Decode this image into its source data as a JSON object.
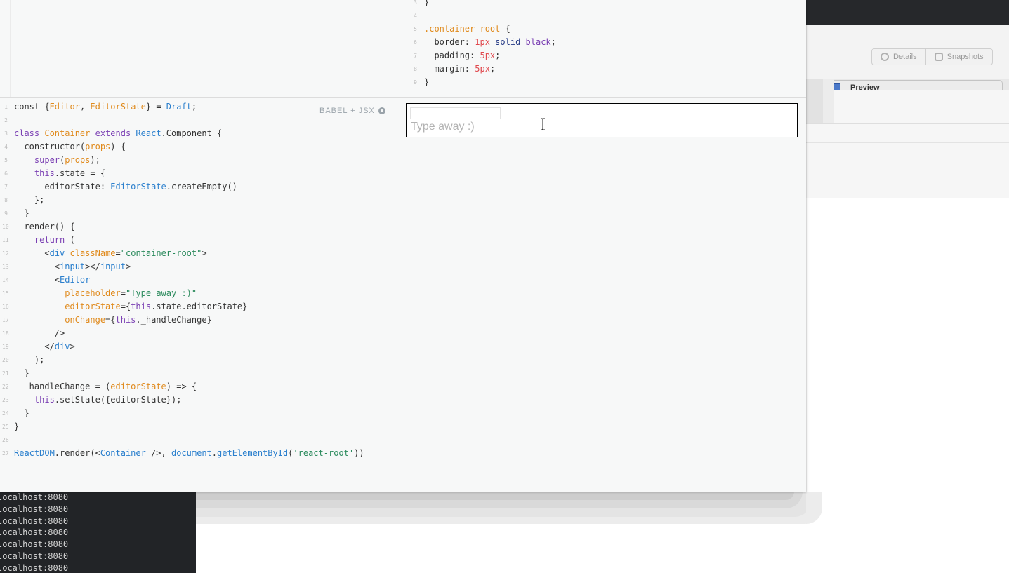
{
  "background_app": {
    "toolbar_buttons": [
      {
        "label": "Details",
        "icon": "gear-icon"
      },
      {
        "label": "Snapshots",
        "icon": "camera-icon"
      }
    ],
    "tab_label": "Preview"
  },
  "css_panel": {
    "lines": [
      {
        "n": "3",
        "tokens": [
          {
            "t": "}",
            "c": ""
          }
        ]
      },
      {
        "n": "4",
        "tokens": []
      },
      {
        "n": "5",
        "tokens": [
          {
            "t": ".container-root",
            "c": "cl"
          },
          {
            "t": " {",
            "c": ""
          }
        ]
      },
      {
        "n": "6",
        "tokens": [
          {
            "t": "  border: ",
            "c": ""
          },
          {
            "t": "1px",
            "c": "num"
          },
          {
            "t": " ",
            "c": ""
          },
          {
            "t": "solid",
            "c": "val"
          },
          {
            "t": " ",
            "c": ""
          },
          {
            "t": "black",
            "c": "kw"
          },
          {
            "t": ";",
            "c": ""
          }
        ]
      },
      {
        "n": "7",
        "tokens": [
          {
            "t": "  padding: ",
            "c": ""
          },
          {
            "t": "5px",
            "c": "num"
          },
          {
            "t": ";",
            "c": ""
          }
        ]
      },
      {
        "n": "8",
        "tokens": [
          {
            "t": "  margin: ",
            "c": ""
          },
          {
            "t": "5px",
            "c": "num"
          },
          {
            "t": ";",
            "c": ""
          }
        ]
      },
      {
        "n": "9",
        "tokens": [
          {
            "t": "}",
            "c": ""
          }
        ]
      }
    ]
  },
  "js_panel": {
    "preprocessor_label": "BABEL + JSX",
    "lines": [
      {
        "n": "1",
        "tokens": [
          {
            "t": "const {",
            "c": ""
          },
          {
            "t": "Editor",
            "c": "cl"
          },
          {
            "t": ", ",
            "c": ""
          },
          {
            "t": "EditorState",
            "c": "cl"
          },
          {
            "t": "} = ",
            "c": ""
          },
          {
            "t": "Draft",
            "c": "ty"
          },
          {
            "t": ";",
            "c": ""
          }
        ]
      },
      {
        "n": "2",
        "tokens": []
      },
      {
        "n": "3",
        "tokens": [
          {
            "t": "class ",
            "c": "kw"
          },
          {
            "t": "Container",
            "c": "cl"
          },
          {
            "t": " extends ",
            "c": "kw"
          },
          {
            "t": "React",
            "c": "ty"
          },
          {
            "t": ".Component {",
            "c": ""
          }
        ]
      },
      {
        "n": "4",
        "tokens": [
          {
            "t": "  constructor(",
            "c": ""
          },
          {
            "t": "props",
            "c": "cl"
          },
          {
            "t": ") {",
            "c": ""
          }
        ]
      },
      {
        "n": "5",
        "tokens": [
          {
            "t": "    ",
            "c": ""
          },
          {
            "t": "super",
            "c": "kw"
          },
          {
            "t": "(",
            "c": ""
          },
          {
            "t": "props",
            "c": "cl"
          },
          {
            "t": ");",
            "c": ""
          }
        ]
      },
      {
        "n": "6",
        "tokens": [
          {
            "t": "    ",
            "c": ""
          },
          {
            "t": "this",
            "c": "kw"
          },
          {
            "t": ".state = {",
            "c": ""
          }
        ]
      },
      {
        "n": "7",
        "tokens": [
          {
            "t": "      editorState: ",
            "c": ""
          },
          {
            "t": "EditorState",
            "c": "ty"
          },
          {
            "t": ".createEmpty()",
            "c": ""
          }
        ]
      },
      {
        "n": "8",
        "tokens": [
          {
            "t": "    };",
            "c": ""
          }
        ]
      },
      {
        "n": "9",
        "tokens": [
          {
            "t": "  }",
            "c": ""
          }
        ]
      },
      {
        "n": "10",
        "tokens": [
          {
            "t": "  render() {",
            "c": ""
          }
        ]
      },
      {
        "n": "11",
        "tokens": [
          {
            "t": "    ",
            "c": ""
          },
          {
            "t": "return",
            "c": "kw"
          },
          {
            "t": " (",
            "c": ""
          }
        ]
      },
      {
        "n": "12",
        "tokens": [
          {
            "t": "      <",
            "c": ""
          },
          {
            "t": "div",
            "c": "tag"
          },
          {
            "t": " ",
            "c": ""
          },
          {
            "t": "className",
            "c": "attr"
          },
          {
            "t": "=",
            "c": ""
          },
          {
            "t": "\"container-root\"",
            "c": "str"
          },
          {
            "t": ">",
            "c": ""
          }
        ]
      },
      {
        "n": "13",
        "tokens": [
          {
            "t": "        <",
            "c": ""
          },
          {
            "t": "input",
            "c": "tag"
          },
          {
            "t": "></",
            "c": ""
          },
          {
            "t": "input",
            "c": "tag"
          },
          {
            "t": ">",
            "c": ""
          }
        ]
      },
      {
        "n": "14",
        "tokens": [
          {
            "t": "        <",
            "c": ""
          },
          {
            "t": "Editor",
            "c": "tag"
          }
        ]
      },
      {
        "n": "15",
        "tokens": [
          {
            "t": "          ",
            "c": ""
          },
          {
            "t": "placeholder",
            "c": "attr"
          },
          {
            "t": "=",
            "c": ""
          },
          {
            "t": "\"Type away :)\"",
            "c": "str"
          }
        ]
      },
      {
        "n": "16",
        "tokens": [
          {
            "t": "          ",
            "c": ""
          },
          {
            "t": "editorState",
            "c": "attr"
          },
          {
            "t": "={",
            "c": ""
          },
          {
            "t": "this",
            "c": "kw"
          },
          {
            "t": ".state.editorState}",
            "c": ""
          }
        ]
      },
      {
        "n": "17",
        "tokens": [
          {
            "t": "          ",
            "c": ""
          },
          {
            "t": "onChange",
            "c": "attr"
          },
          {
            "t": "={",
            "c": ""
          },
          {
            "t": "this",
            "c": "kw"
          },
          {
            "t": "._handleChange}",
            "c": ""
          }
        ]
      },
      {
        "n": "18",
        "tokens": [
          {
            "t": "        />",
            "c": ""
          }
        ]
      },
      {
        "n": "19",
        "tokens": [
          {
            "t": "      </",
            "c": ""
          },
          {
            "t": "div",
            "c": "tag"
          },
          {
            "t": ">",
            "c": ""
          }
        ]
      },
      {
        "n": "20",
        "tokens": [
          {
            "t": "    );",
            "c": ""
          }
        ]
      },
      {
        "n": "21",
        "tokens": [
          {
            "t": "  }",
            "c": ""
          }
        ]
      },
      {
        "n": "22",
        "tokens": [
          {
            "t": "  _handleChange = (",
            "c": ""
          },
          {
            "t": "editorState",
            "c": "cl"
          },
          {
            "t": ") => {",
            "c": ""
          }
        ]
      },
      {
        "n": "23",
        "tokens": [
          {
            "t": "    ",
            "c": ""
          },
          {
            "t": "this",
            "c": "kw"
          },
          {
            "t": ".setState({editorState});",
            "c": ""
          }
        ]
      },
      {
        "n": "24",
        "tokens": [
          {
            "t": "  }",
            "c": ""
          }
        ]
      },
      {
        "n": "25",
        "tokens": [
          {
            "t": "}",
            "c": ""
          }
        ]
      },
      {
        "n": "26",
        "tokens": []
      },
      {
        "n": "27",
        "tokens": [
          {
            "t": "ReactDOM",
            "c": "ty"
          },
          {
            "t": ".render(<",
            "c": ""
          },
          {
            "t": "Container",
            "c": "tag"
          },
          {
            "t": " />, ",
            "c": ""
          },
          {
            "t": "document",
            "c": "ty"
          },
          {
            "t": ".",
            "c": ""
          },
          {
            "t": "getElementById",
            "c": "ty"
          },
          {
            "t": "(",
            "c": ""
          },
          {
            "t": "'react-root'",
            "c": "str"
          },
          {
            "t": "))",
            "c": ""
          }
        ]
      }
    ]
  },
  "result_panel": {
    "editor_placeholder": "Type away :)"
  },
  "terminal": {
    "lines": [
      "localhost:8080",
      "localhost:8080",
      "localhost:8080",
      "localhost:8080",
      "localhost:8080",
      "localhost:8080",
      "localhost:8080"
    ]
  },
  "colors": {
    "keyword": "#7a3fb3",
    "type": "#2a7fcd",
    "class": "#e08a1c",
    "string": "#2a8a5c",
    "number": "#e0484d",
    "value": "#263b86",
    "terminal_bg": "#222427"
  }
}
